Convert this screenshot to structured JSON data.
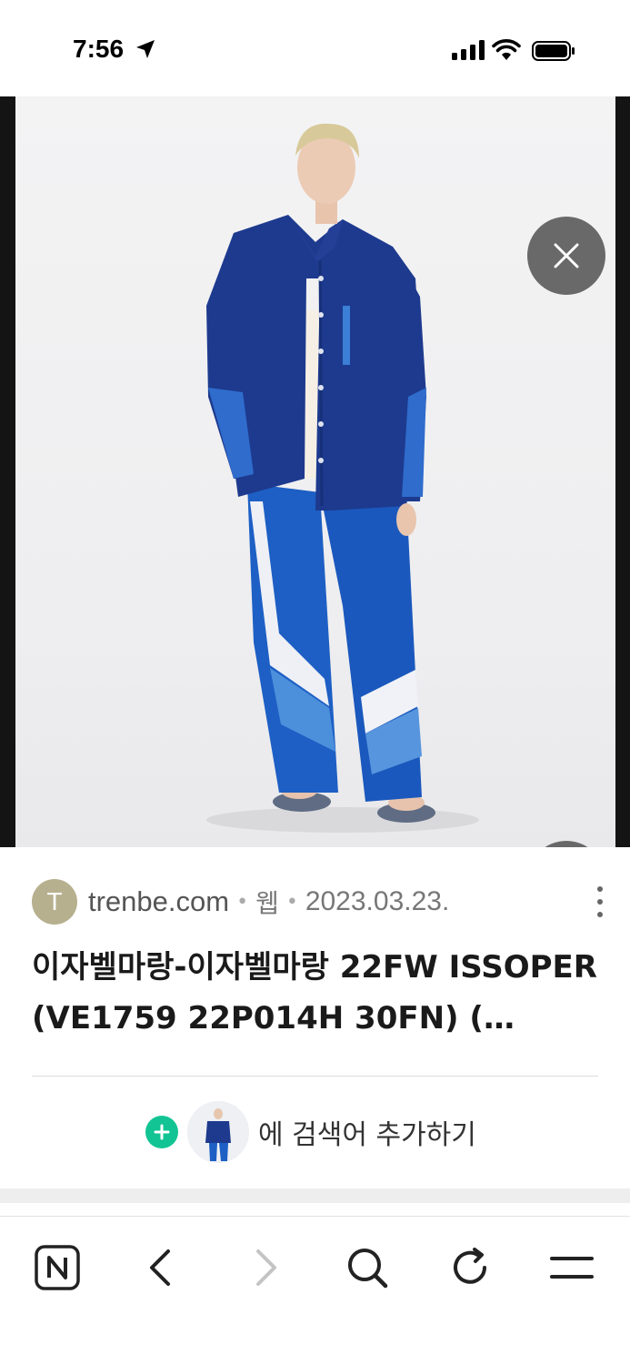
{
  "status_bar": {
    "time": "7:56",
    "icons": [
      "location-arrow-icon",
      "cellular-signal-icon",
      "wifi-icon",
      "battery-icon"
    ]
  },
  "viewer": {
    "image_alt": "",
    "buttons": {
      "close": "close-icon",
      "lens": "image-search-icon"
    }
  },
  "result": {
    "site_initial": "T",
    "site_name": "trenbe.com",
    "separator": "•",
    "type": "웹",
    "date": "2023.03.23.",
    "title": "이자벨마랑-이자벨마랑 22FW ISSOPER (VE1759 22P014H 30FN) (…",
    "add_keyword_label": "에 검색어 추가하기"
  },
  "bottom_nav": {
    "items": [
      "naver-home-icon",
      "back-icon",
      "forward-icon",
      "search-icon",
      "refresh-icon",
      "menu-icon"
    ]
  },
  "colors": {
    "accent_green": "#12c493",
    "avatar_bg": "#b7b08f",
    "overlay_button": "#5a5a5a"
  }
}
